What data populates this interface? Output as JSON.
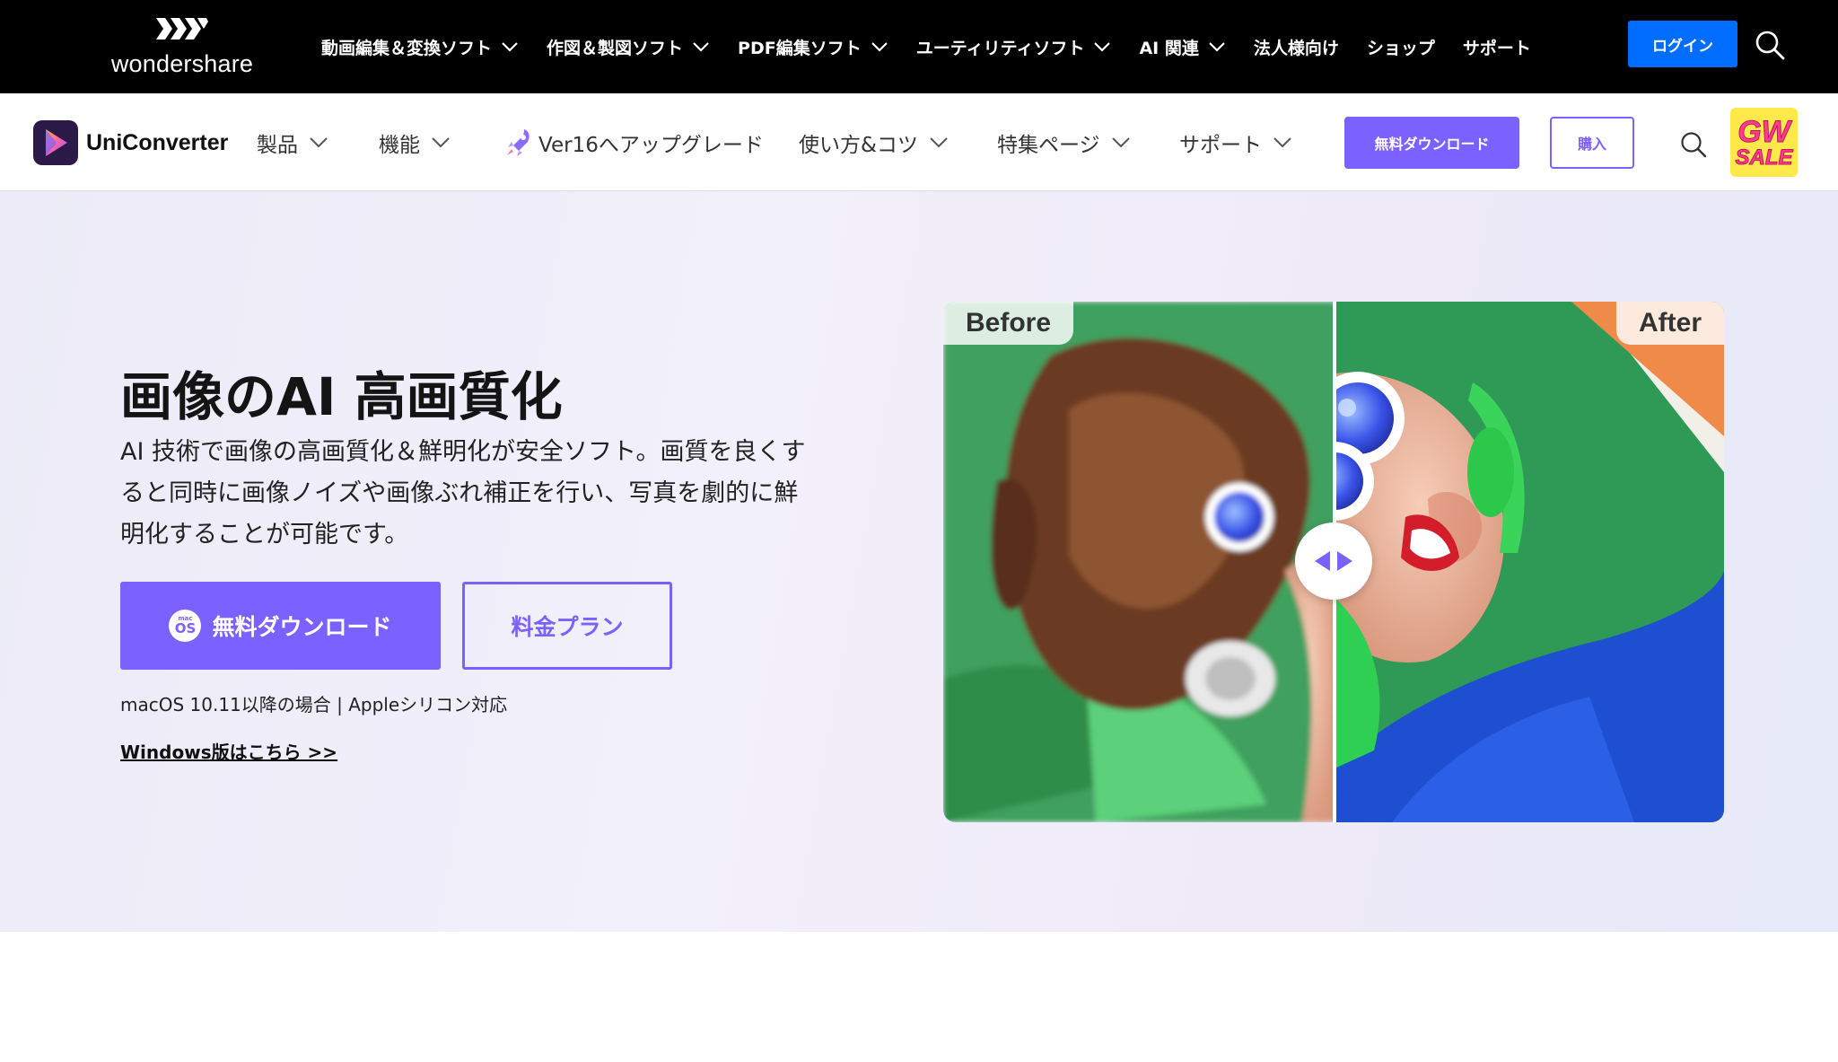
{
  "topbar": {
    "brand": "wondershare",
    "nav": [
      {
        "label": "動画編集＆変換ソフト",
        "dropdown": true
      },
      {
        "label": "作図＆製図ソフト",
        "dropdown": true
      },
      {
        "label": "PDF編集ソフト",
        "dropdown": true
      },
      {
        "label": "ユーティリティソフト",
        "dropdown": true
      },
      {
        "label": "AI 関連",
        "dropdown": true
      },
      {
        "label": "法人様向け",
        "dropdown": false
      },
      {
        "label": "ショップ",
        "dropdown": false
      },
      {
        "label": "サポート",
        "dropdown": false
      }
    ],
    "login_label": "ログイン",
    "login_color": "#006dff",
    "search_icon": "search-icon"
  },
  "product_nav": {
    "product_name": "UniConverter",
    "items": [
      {
        "label": "製品",
        "dropdown": true
      },
      {
        "label": "機能",
        "dropdown": true
      },
      {
        "label": "Ver16へアップグレード",
        "dropdown": false,
        "icon": "rocket-icon"
      },
      {
        "label": "使い方&コツ",
        "dropdown": true
      },
      {
        "label": "特集ページ",
        "dropdown": true
      },
      {
        "label": "サポート",
        "dropdown": true
      }
    ],
    "download_label": "無料ダウンロード",
    "buy_label": "購入",
    "badge_line1": "GW",
    "badge_line2": "SALE",
    "accent_color": "#7b61ff"
  },
  "hero": {
    "title": "画像のAI 高画質化",
    "description": "AI 技術で画像の高画質化＆鮮明化が安全ソフト。画質を良くすると同時に画像ノイズや画像ぶれ補正を行い、写真を劇的に鮮明化することが可能です。",
    "download_label": "無料ダウンロード",
    "os_badge_small": "mac",
    "os_badge_large": "OS",
    "pricing_label": "料金プラン",
    "requirement": "macOS 10.11以降の場合 | Appleシリコン対応",
    "windows_link": "Windows版はこちら >>",
    "compare": {
      "before_label": "Before",
      "after_label": "After",
      "split_position": 0.5
    }
  }
}
